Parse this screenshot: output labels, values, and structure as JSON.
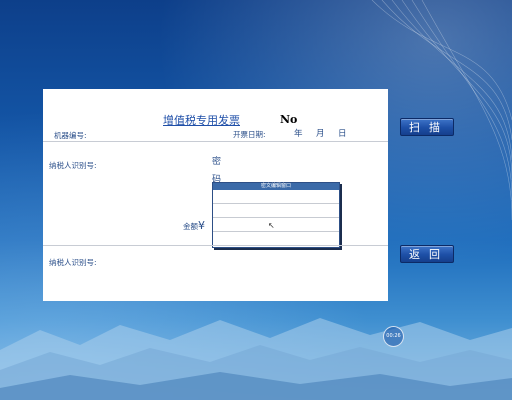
{
  "invoice": {
    "title": "增值税专用发票",
    "no_label": "No",
    "machine_no_label": "机器编号:",
    "issue_date_label": "开票日期:",
    "year": "年",
    "month": "月",
    "day": "日",
    "taxpayer_id_label_top": "纳税人识别号:",
    "code_char_1": "密",
    "code_char_2": "码",
    "amount_label": "金额",
    "yen": "¥",
    "taxpayer_id_label_bottom": "纳税人识别号:"
  },
  "code_window": {
    "title": "密文编辑窗口"
  },
  "buttons": {
    "scan": "扫描",
    "back": "返回"
  },
  "timer": {
    "value": "00:26"
  }
}
